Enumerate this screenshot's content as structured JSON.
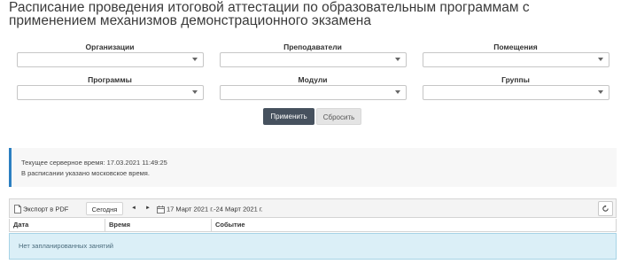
{
  "page": {
    "title": "Расписание проведения итоговой аттестации по образовательным программам с применением механизмов демонстрационного экзамена"
  },
  "filters": {
    "row1": [
      {
        "label": "Организации",
        "value": ""
      },
      {
        "label": "Преподаватели",
        "value": ""
      },
      {
        "label": "Помещения",
        "value": ""
      }
    ],
    "row2": [
      {
        "label": "Программы",
        "value": ""
      },
      {
        "label": "Модули",
        "value": ""
      },
      {
        "label": "Группы",
        "value": ""
      }
    ]
  },
  "actions": {
    "apply_label": "Применить",
    "reset_label": "Сбросить"
  },
  "info": {
    "server_time": "Текущее серверное время: 17.03.2021 11:49:25",
    "timezone_note": "В расписании указано московское время."
  },
  "toolbar": {
    "export_label": "Экспорт в PDF",
    "today_label": "Сегодня",
    "prev_label": "◄",
    "next_label": "►",
    "date_range": "17 Март 2021 г.-24 Март 2021 г.",
    "icons": {
      "export": "pdf-document-icon",
      "calendar": "calendar-icon",
      "refresh": "refresh-icon"
    }
  },
  "table": {
    "columns": [
      "Дата",
      "Время",
      "Событие"
    ],
    "empty_message": "Нет запланированных занятий"
  },
  "colors": {
    "apply_bg": "#46515e",
    "info_accent": "#2c7fc1",
    "empty_row_bg": "#dbeff7"
  }
}
